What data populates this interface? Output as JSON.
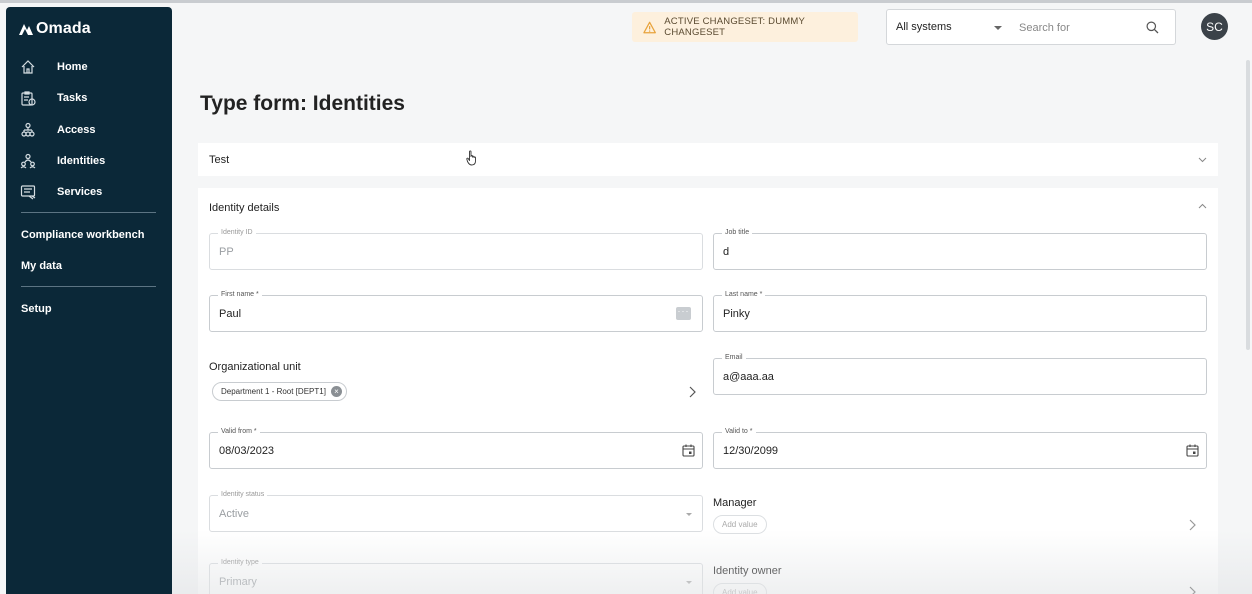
{
  "app": {
    "brand": "Omada",
    "user_initials": "SC"
  },
  "sidebar": {
    "items": [
      {
        "label": "Home",
        "icon": "home-icon"
      },
      {
        "label": "Tasks",
        "icon": "tasks-icon"
      },
      {
        "label": "Access",
        "icon": "access-icon"
      },
      {
        "label": "Identities",
        "icon": "identities-icon"
      },
      {
        "label": "Services",
        "icon": "services-icon"
      }
    ],
    "links": [
      {
        "label": "Compliance workbench"
      },
      {
        "label": "My data"
      },
      {
        "label": "Setup"
      }
    ]
  },
  "topbar": {
    "changeset": "ACTIVE CHANGESET: DUMMY CHANGESET",
    "system_select": "All systems",
    "search_placeholder": "Search for"
  },
  "page": {
    "title": "Type form: Identities"
  },
  "panels": {
    "test": {
      "title": "Test"
    },
    "details": {
      "title": "Identity details"
    }
  },
  "fields": {
    "identity_id": {
      "label": "Identity ID",
      "value": "PP"
    },
    "job_title": {
      "label": "Job title",
      "value": "d"
    },
    "first_name": {
      "label": "First name *",
      "value": "Paul"
    },
    "last_name": {
      "label": "Last name *",
      "value": "Pinky"
    },
    "org_unit": {
      "label": "Organizational unit",
      "chip": "Department 1 - Root [DEPT1]"
    },
    "email": {
      "label": "Email",
      "value": "a@aaa.aa"
    },
    "valid_from": {
      "label": "Valid from *",
      "value": "08/03/2023"
    },
    "valid_to": {
      "label": "Valid to *",
      "value": "12/30/2099"
    },
    "identity_status": {
      "label": "Identity status",
      "value": "Active"
    },
    "manager": {
      "label": "Manager",
      "add": "Add value"
    },
    "identity_type": {
      "label": "Identity type",
      "value": "Primary"
    },
    "identity_owner": {
      "label": "Identity owner",
      "add": "Add value"
    }
  },
  "colors": {
    "sidebar_bg": "#0b2838",
    "changeset_bg": "#fdf0dd",
    "warning": "#e8a33c",
    "avatar_bg": "#3b4249"
  }
}
